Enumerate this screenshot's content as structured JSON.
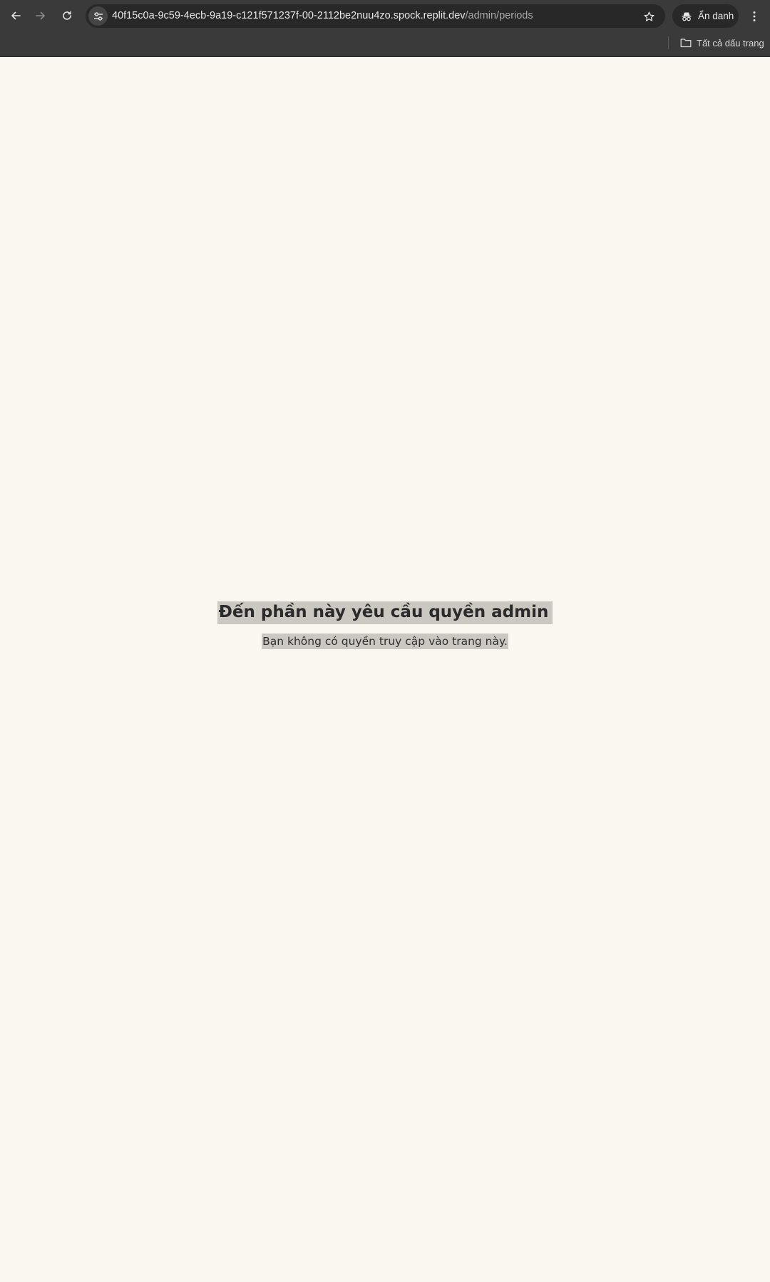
{
  "browser": {
    "url_host": "40f15c0a-9c59-4ecb-9a19-c121f571237f-00-2112be2nuu4zo.spock.replit.dev",
    "url_path": "/admin/periods",
    "incognito_label": "Ẩn danh",
    "bookmarks_label": "Tất cả dấu trang",
    "icons": [
      "back-arrow-icon",
      "forward-arrow-icon",
      "reload-icon",
      "site-settings-icon",
      "star-icon",
      "incognito-icon",
      "more-vert-icon",
      "folder-icon"
    ]
  },
  "page": {
    "heading": "Đến phần này yêu cầu quyền admin",
    "subtext": "Bạn không có quyền truy cập vào trang này.",
    "background_color": "#faf7f0",
    "highlight_color": "#cbc8c2"
  }
}
